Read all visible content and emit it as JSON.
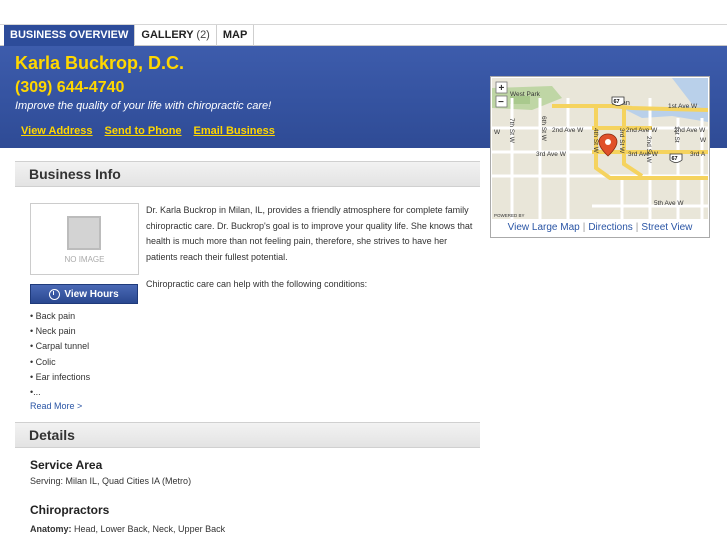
{
  "tabs": [
    {
      "label": "BUSINESS OVERVIEW",
      "count": ""
    },
    {
      "label": "GALLERY",
      "count": "(2)"
    },
    {
      "label": "MAP",
      "count": ""
    }
  ],
  "business": {
    "name": "Karla Buckrop, D.C.",
    "phone": "(309) 644-4740",
    "tagline": "Improve the quality of your life with chiropractic care!",
    "links": [
      "View Address",
      "Send to Phone",
      "Email Business"
    ]
  },
  "map": {
    "zoom_in": "+",
    "zoom_out": "−",
    "labels": {
      "west_park": "West Park",
      "milan": "Milan",
      "route_67": "67",
      "first_ave": "1st Ave W",
      "second_ave_w1": "2nd Ave W",
      "second_ave_w2": "2nd Ave W",
      "second_ave_w3": "2nd Ave W",
      "third_ave_w1": "3rd Ave W",
      "third_ave_w2": "3rd Ave W",
      "third_ave_w3": "3rd A",
      "fifth_ave": "5th Ave W",
      "fourth_st": "4th St W",
      "third_st": "3rd St W",
      "second_st": "2nd St W",
      "first_st": "1st St",
      "sixth_st": "6th St W",
      "seventh_st": "7th St W",
      "w_left": "W",
      "w_right": "W",
      "powered": "POWERED BY"
    },
    "link_large": "View Large Map",
    "link_directions": "Directions",
    "link_street": "Street View",
    "separator": "|"
  },
  "business_info": {
    "heading": "Business Info",
    "no_image": "NO IMAGE",
    "hours_button": "View Hours",
    "description": "Dr. Karla Buckrop in Milan, IL, provides a friendly atmosphere for complete family chiropractic care. Dr. Buckrop's goal is to improve your quality life. She knows that health is much more than not feeling pain, therefore, she strives to have her patients reach their fullest potential.",
    "conditions_intro": "Chiropractic care can help with the following conditions:",
    "conditions": [
      "• Back pain",
      "• Neck pain",
      "• Carpal tunnel",
      "• Colic",
      "• Ear infections",
      "•..."
    ],
    "read_more": "Read More >"
  },
  "details": {
    "heading": "Details",
    "service_area_heading": "Service Area",
    "service_area_text": "Serving: Milan IL, Quad Cities IA (Metro)",
    "chiropractors_heading": "Chiropractors",
    "anatomy_label": "Anatomy:",
    "anatomy_value": " Head, Lower Back, Neck, Upper Back"
  }
}
